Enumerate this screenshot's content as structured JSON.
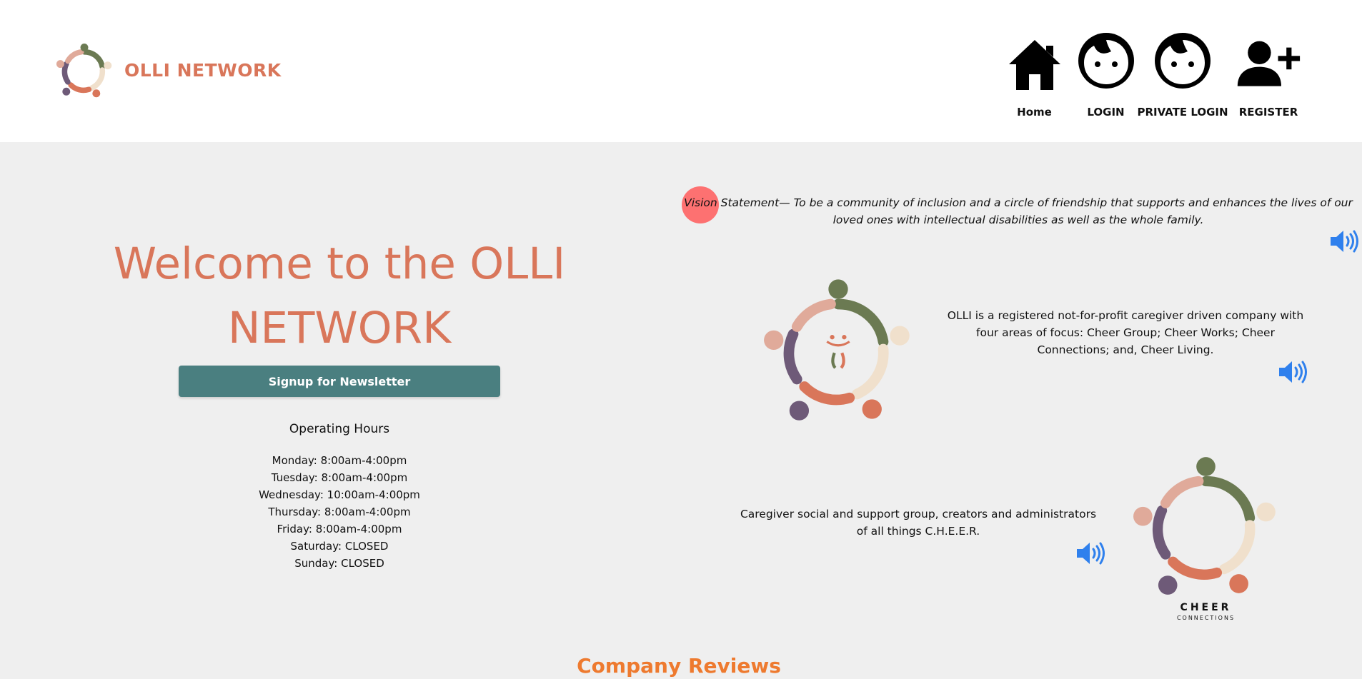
{
  "header": {
    "brand": "OLLI NETWORK",
    "nav": [
      {
        "label": "Home",
        "icon": "home-icon"
      },
      {
        "label": "LOGIN",
        "icon": "face-icon"
      },
      {
        "label": "PRIVATE LOGIN",
        "icon": "face-icon"
      },
      {
        "label": "REGISTER",
        "icon": "add-user-icon"
      }
    ]
  },
  "main": {
    "welcome": "Welcome to the OLLI NETWORK",
    "signup_label": "Signup for Newsletter",
    "hours_title": "Operating Hours",
    "hours": [
      "Monday: 8:00am-4:00pm",
      "Tuesday: 8:00am-4:00pm",
      "Wednesday: 10:00am-4:00pm",
      "Thursday: 8:00am-4:00pm",
      "Friday: 8:00am-4:00pm",
      "Saturday: CLOSED",
      "Sunday: CLOSED"
    ],
    "vision": "Vision Statement— To be a community of inclusion and a circle of friendship that supports and enhances the lives of our loved ones with intellectual disabilities as well as the whole family.",
    "about": "OLLI is a registered not-for-profit caregiver driven company with four areas of focus: Cheer Group; Cheer Works; Cheer Connections; and, Cheer Living.",
    "cheer_desc": "Caregiver social and support group, creators and administrators of all things C.H.E.E.R.",
    "cheer_logo_title": "CHEER",
    "cheer_logo_sub": "CONNECTIONS",
    "reviews_title": "Company Reviews"
  },
  "colors": {
    "brand": "#d9765a",
    "button": "#4a7f80",
    "speaker": "#2f80ed",
    "reviews": "#ee7a2f"
  }
}
